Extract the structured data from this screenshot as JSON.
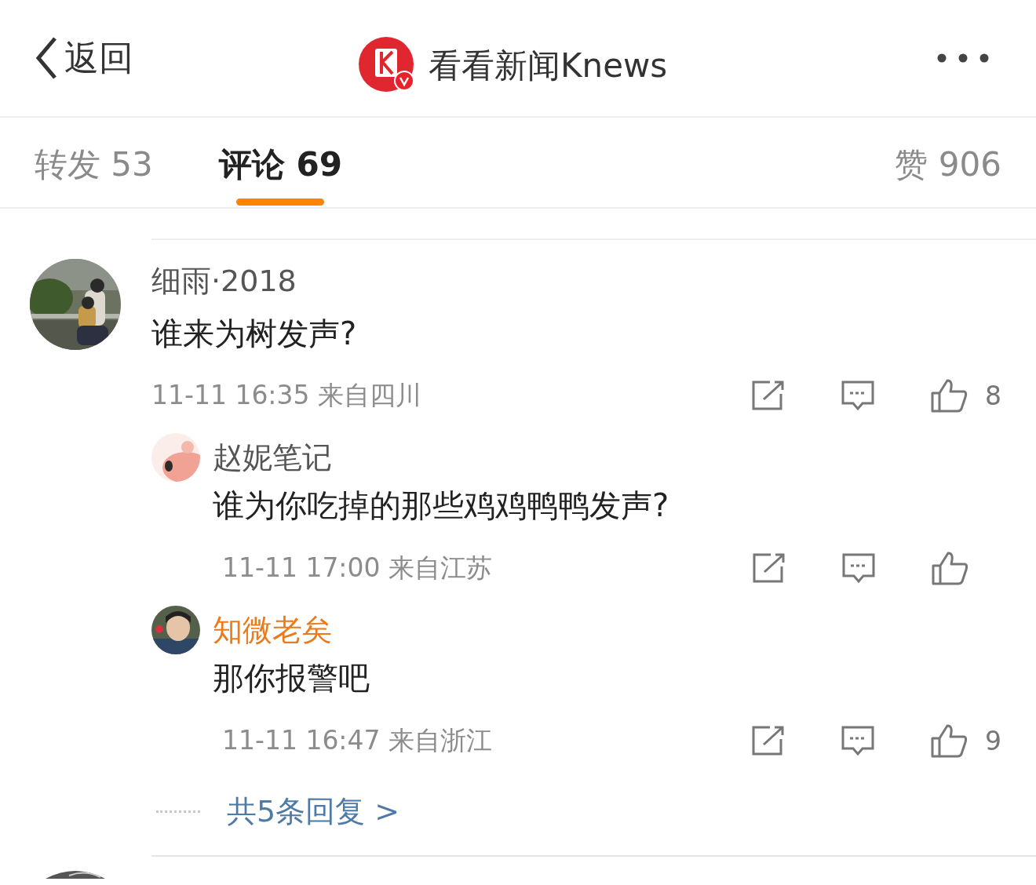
{
  "header": {
    "back": "返回",
    "account": "看看新闻Knews",
    "verified": true
  },
  "tabs": [
    {
      "label": "转发 53",
      "selected": false
    },
    {
      "label": "评论 69",
      "selected": true
    },
    {
      "label": "赞 906",
      "selected": false
    }
  ],
  "comment": {
    "user": "细雨·2018",
    "text": "谁来为树发声?",
    "meta": "11-11 16:35 来自四川",
    "likes": "8",
    "replies": [
      {
        "user": "赵妮笔记",
        "author": false,
        "text": "谁为你吃掉的那些鸡鸡鸭鸭发声?",
        "meta": "11-11 17:00 来自江苏"
      },
      {
        "user": "知微老矣",
        "author": true,
        "text": "那你报警吧",
        "meta": "11-11 16:47 来自浙江",
        "likes": "9"
      }
    ],
    "more_replies": "共5条回复 >"
  }
}
